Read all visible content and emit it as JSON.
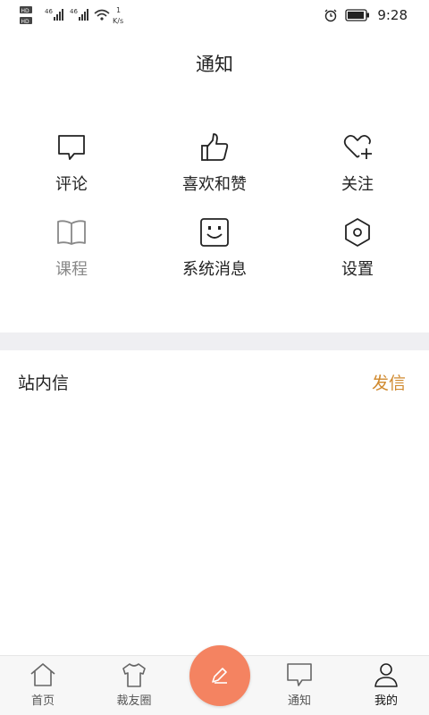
{
  "status_bar": {
    "left_text": "HD 46 46",
    "net_speed": "1\nK/s",
    "time": "9:28"
  },
  "header": {
    "title": "通知"
  },
  "notification_grid": [
    {
      "label": "评论",
      "icon": "comment-icon"
    },
    {
      "label": "喜欢和赞",
      "icon": "thumbs-up-icon"
    },
    {
      "label": "关注",
      "icon": "heart-plus-icon"
    },
    {
      "label": "课程",
      "icon": "book-icon",
      "muted": true
    },
    {
      "label": "系统消息",
      "icon": "smile-face-icon"
    },
    {
      "label": "设置",
      "icon": "hexagon-settings-icon"
    }
  ],
  "inbox": {
    "title": "站内信",
    "action": "发信"
  },
  "tabbar": [
    {
      "label": "首页",
      "icon": "home-icon"
    },
    {
      "label": "裁友圈",
      "icon": "shirt-icon"
    },
    {
      "label": "通知",
      "icon": "message-icon"
    },
    {
      "label": "我的",
      "icon": "person-icon",
      "active": true
    }
  ],
  "colors": {
    "accent": "#d0892e",
    "fab": "#f48361",
    "divider": "#efeff2"
  }
}
